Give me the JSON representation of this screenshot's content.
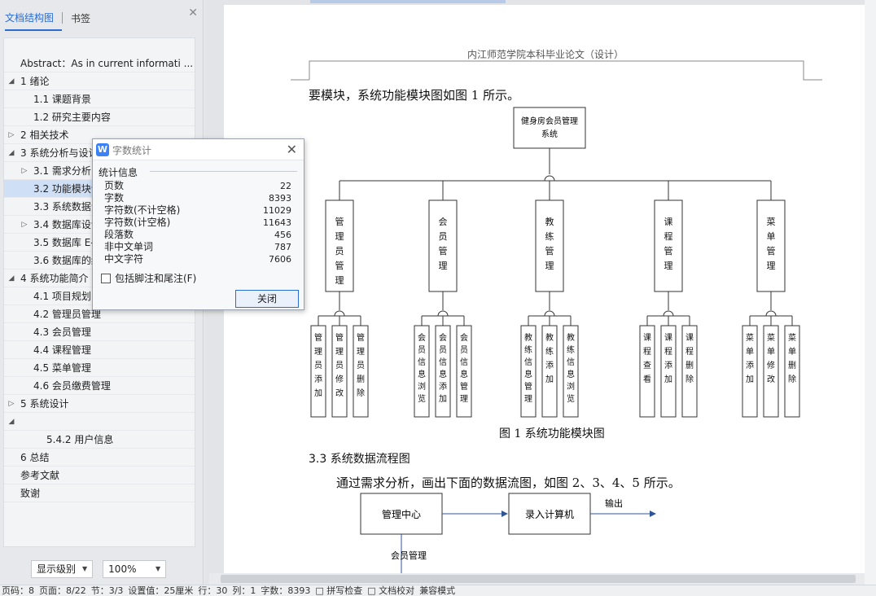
{
  "nav": {
    "tabs": [
      "文档结构图",
      "书签"
    ],
    "items": [
      {
        "label": "Abstract：As in current informati ...",
        "level": 0,
        "arrow": ""
      },
      {
        "label": "1 绪论",
        "level": 0,
        "arrow": "◢"
      },
      {
        "label": "1.1 课题背景",
        "level": 1,
        "arrow": ""
      },
      {
        "label": "1.2  研究主要内容",
        "level": 1,
        "arrow": ""
      },
      {
        "label": "2  相关技术",
        "level": 0,
        "arrow": "▷"
      },
      {
        "label": "3  系统分析与设计",
        "level": 0,
        "arrow": "◢"
      },
      {
        "label": "3.1  需求分析",
        "level": 1,
        "arrow": "▷"
      },
      {
        "label": "3.2  功能模块设计",
        "level": 1,
        "arrow": "",
        "selected": true
      },
      {
        "label": "3.3  系统数据流程图",
        "level": 1,
        "arrow": ""
      },
      {
        "label": "3.4  数据库设计",
        "level": 1,
        "arrow": "▷"
      },
      {
        "label": "3.5  数据库 E-R 图",
        "level": 1,
        "arrow": ""
      },
      {
        "label": "3.6  数据库的结构",
        "level": 1,
        "arrow": ""
      },
      {
        "label": "4  系统功能简介",
        "level": 0,
        "arrow": "◢"
      },
      {
        "label": "4.1  项目规划",
        "level": 1,
        "arrow": ""
      },
      {
        "label": "4.2  管理员管理",
        "level": 1,
        "arrow": ""
      },
      {
        "label": "4.3  会员管理",
        "level": 1,
        "arrow": ""
      },
      {
        "label": "4.4  课程管理",
        "level": 1,
        "arrow": ""
      },
      {
        "label": "4.5  菜单管理",
        "level": 1,
        "arrow": ""
      },
      {
        "label": "4.6  会员缴费管理",
        "level": 1,
        "arrow": ""
      },
      {
        "label": "5  系统设计",
        "level": 0,
        "arrow": "▷"
      },
      {
        "label": "",
        "level": 0,
        "arrow": "◢"
      },
      {
        "label": "5.4.2  用户信息",
        "level": 2,
        "arrow": ""
      },
      {
        "label": "6  总结",
        "level": 0,
        "arrow": ""
      },
      {
        "label": "参考文献",
        "level": 0,
        "arrow": ""
      },
      {
        "label": "致谢",
        "level": 0,
        "arrow": ""
      }
    ],
    "level_select": "显示级别",
    "zoom_select": "100%"
  },
  "doc": {
    "header": "内江师范学院本科毕业论文（设计）",
    "para1": "要模块，系统功能模块图如图 1 所示。",
    "diagram": {
      "root": "健身房会员管理系统",
      "modules": [
        {
          "name": "管理员管理",
          "children": [
            "管理员添加",
            "管理员修改",
            "管理员删除"
          ]
        },
        {
          "name": "会员管理",
          "children": [
            "会员信息浏览",
            "会员信息添加",
            "会员信息管理"
          ]
        },
        {
          "name": "教练管理",
          "children": [
            "教练信息管理",
            "教练添加",
            "教练信息浏览"
          ]
        },
        {
          "name": "课程管理",
          "children": [
            "课程查看",
            "课程添加",
            "课程删除"
          ]
        },
        {
          "name": "菜单管理",
          "children": [
            "菜单添加",
            "菜单修改",
            "菜单删除"
          ]
        }
      ],
      "caption": "图 1  系统功能模块图"
    },
    "section_title": "3.3  系统数据流程图",
    "para2": "通过需求分析，画出下面的数据流图，如图 2、3、4、5 所示。",
    "flow": {
      "box1": "管理中心",
      "box2": "录入计算机",
      "out_label": "输出",
      "down_label": "会员管理"
    }
  },
  "dialog": {
    "title": "字数统计",
    "section": "统计信息",
    "stats": [
      {
        "label": "页数",
        "value": "22"
      },
      {
        "label": "字数",
        "value": "8393"
      },
      {
        "label": "字符数(不计空格)",
        "value": "11029"
      },
      {
        "label": "字符数(计空格)",
        "value": "11643"
      },
      {
        "label": "段落数",
        "value": "456"
      },
      {
        "label": "非中文单词",
        "value": "787"
      },
      {
        "label": "中文字符",
        "value": "7606"
      }
    ],
    "checkbox": "包括脚注和尾注(F)",
    "close_button": "关闭"
  },
  "status": [
    "页码：8",
    "页面：8/22",
    "节：3/3",
    "设置值：25厘米",
    "行：30",
    "列：1",
    "字数：8393",
    "□ 拼写检查",
    "□ 文档校对",
    "兼容模式"
  ]
}
